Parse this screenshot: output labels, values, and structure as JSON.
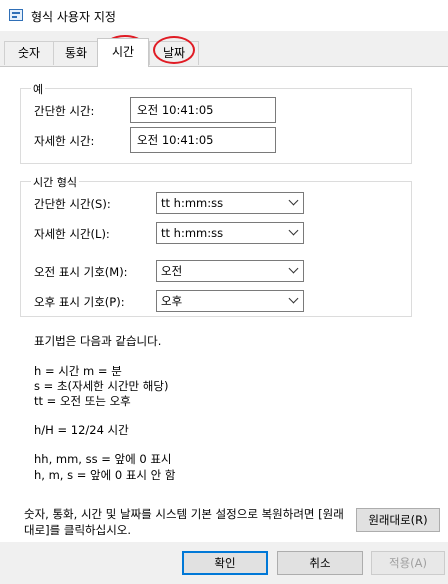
{
  "window": {
    "title": "형식 사용자 지정"
  },
  "tabs": [
    {
      "label": "숫자"
    },
    {
      "label": "통화"
    },
    {
      "label": "시간"
    },
    {
      "label": "날짜"
    }
  ],
  "example": {
    "group_title": "예",
    "short_time_label": "간단한 시간:",
    "short_time_value": "오전 10:41:05",
    "long_time_label": "자세한 시간:",
    "long_time_value": "오전 10:41:05"
  },
  "time_format": {
    "group_title": "시간 형식",
    "short_time_label": "간단한 시간(S):",
    "short_time_value": "tt h:mm:ss",
    "long_time_label": "자세한 시간(L):",
    "long_time_value": "tt h:mm:ss",
    "am_label": "오전 표시 기호(M):",
    "am_value": "오전",
    "pm_label": "오후 표시 기호(P):",
    "pm_value": "오후"
  },
  "notation": {
    "heading": "표기법은 다음과 같습니다.",
    "line1": "h = 시간   m = 분",
    "line2": "s = 초(자세한 시간만 해당)",
    "line3": "tt = 오전 또는 오후",
    "line4": "h/H = 12/24 시간",
    "line5": "hh, mm, ss = 앞에 0 표시",
    "line6": "h, m, s = 앞에 0 표시 안 함"
  },
  "restore": {
    "text": "숫자, 통화, 시간 및 날짜를 시스템 기본 설정으로 복원하려면 [원래대로]를 클릭하십시오.",
    "button_label": "원래대로(R)"
  },
  "buttons": {
    "ok": "확인",
    "cancel": "취소",
    "apply": "적용(A)"
  },
  "colors": {
    "highlight_circle": "#e01b24",
    "primary_border": "#0078d7"
  }
}
